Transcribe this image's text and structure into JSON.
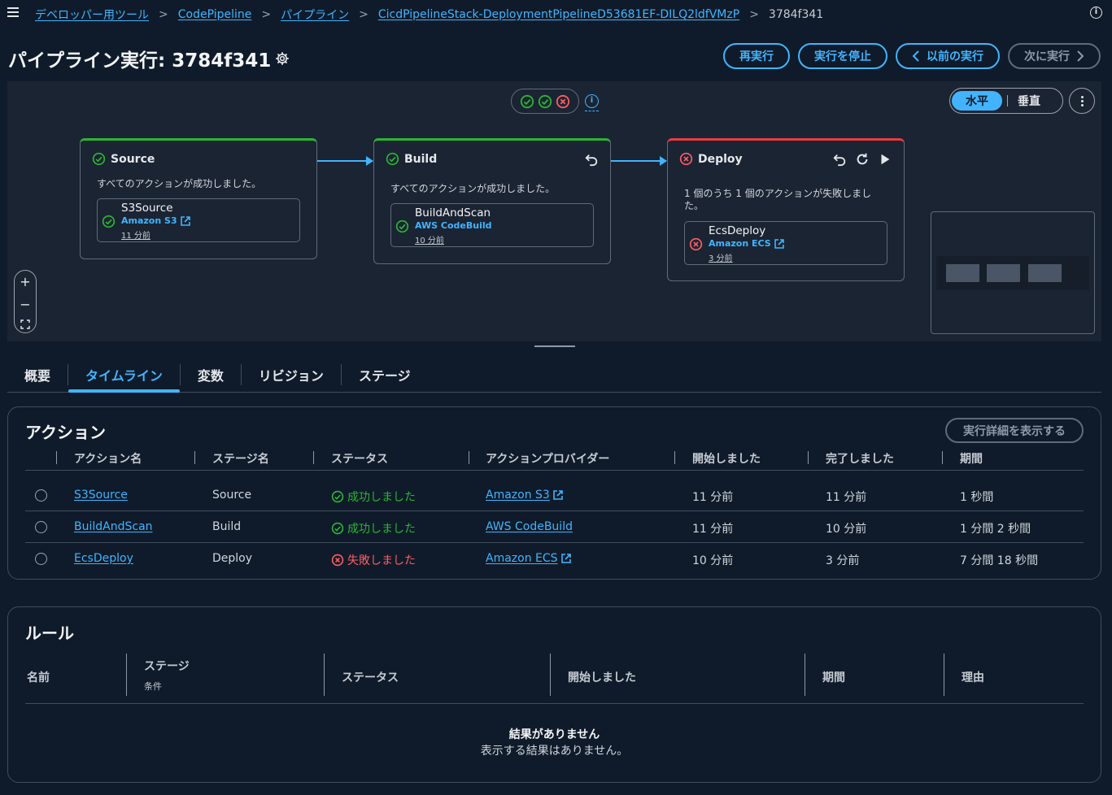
{
  "breadcrumb": {
    "items": [
      "デベロッパー用ツール",
      "CodePipeline",
      "パイプライン",
      "CicdPipelineStack-DeploymentPipelineD53681EF-DILQ2ldfVMzP"
    ],
    "current": "3784f341"
  },
  "header": {
    "title": "パイプライン実行: 3784f341",
    "buttons": {
      "rerun": "再実行",
      "stop": "実行を停止",
      "prev": "以前の実行",
      "next": "次に実行"
    }
  },
  "canvas": {
    "layout_toggle": {
      "horizontal": "水平",
      "vertical": "垂直"
    },
    "stages": [
      {
        "name": "Source",
        "status": "success",
        "message": "すべてのアクションが成功しました。",
        "action": {
          "name": "S3Source",
          "provider": "Amazon S3",
          "time": "11 分前"
        }
      },
      {
        "name": "Build",
        "status": "success",
        "message": "すべてのアクションが成功しました。",
        "action": {
          "name": "BuildAndScan",
          "provider": "AWS CodeBuild",
          "time": "10 分前"
        }
      },
      {
        "name": "Deploy",
        "status": "failed",
        "message": "1 個のうち 1 個のアクションが失敗しました。",
        "action": {
          "name": "EcsDeploy",
          "provider": "Amazon ECS",
          "time": "3 分前"
        }
      }
    ]
  },
  "tabs": [
    "概要",
    "タイムライン",
    "変数",
    "リビジョン",
    "ステージ"
  ],
  "actions_panel": {
    "title": "アクション",
    "details_button": "実行詳細を表示する",
    "columns": [
      "アクション名",
      "ステージ名",
      "ステータス",
      "アクションプロバイダー",
      "開始しました",
      "完了しました",
      "期間"
    ],
    "rows": [
      {
        "name": "S3Source",
        "stage": "Source",
        "status": "成功しました",
        "provider": "Amazon S3",
        "started": "11 分前",
        "completed": "11 分前",
        "duration": "1 秒間"
      },
      {
        "name": "BuildAndScan",
        "stage": "Build",
        "status": "成功しました",
        "provider": "AWS CodeBuild",
        "started": "11 分前",
        "completed": "10 分前",
        "duration": "1 分間 2 秒間"
      },
      {
        "name": "EcsDeploy",
        "stage": "Deploy",
        "status": "失敗しました",
        "provider": "Amazon ECS",
        "started": "10 分前",
        "completed": "3 分前",
        "duration": "7 分間 18 秒間"
      }
    ]
  },
  "rules_panel": {
    "title": "ルール",
    "columns": {
      "name": "名前",
      "stage": "ステージ",
      "condition": "条件",
      "status": "ステータス",
      "started": "開始しました",
      "duration": "期間",
      "reason": "理由"
    },
    "empty_title": "結果がありません",
    "empty_message": "表示する結果はありません。"
  },
  "colors": {
    "accent": "#42b4ff",
    "success": "#2bb534",
    "error": "#eb3b3b",
    "background": "#0f1b2a"
  }
}
